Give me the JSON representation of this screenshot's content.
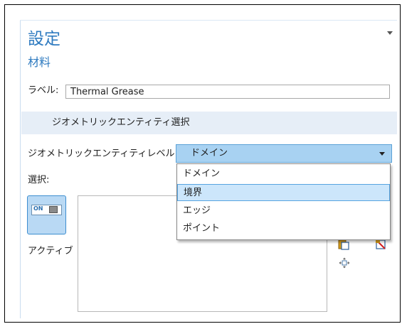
{
  "settings": {
    "title": "設定",
    "subtitle": "材料"
  },
  "label_field": {
    "label": "ラベル:",
    "value": "Thermal Grease"
  },
  "geometric_entity_selection": {
    "section_title": "ジオメトリックエンティティ選択",
    "level_label": "ジオメトリックエンティティレベル:",
    "level_value": "ドメイン",
    "level_options": [
      "ドメイン",
      "境界",
      "エッジ",
      "ポイント"
    ],
    "highlighted_option": "境界",
    "selection_label": "選択:",
    "active_toggle_text": "ON",
    "active_label": "アクティブ"
  },
  "colors": {
    "title_blue": "#2f7bc0",
    "select_blue": "#a8d2f2",
    "section_bg": "#e6eef7",
    "highlight": "#cce6fb"
  },
  "icons": [
    "collapse-arrow-icon",
    "chevron-down-icon",
    "toggle-on-icon",
    "paste-selection-icon",
    "clear-selection-icon",
    "zoom-to-selection-icon"
  ]
}
